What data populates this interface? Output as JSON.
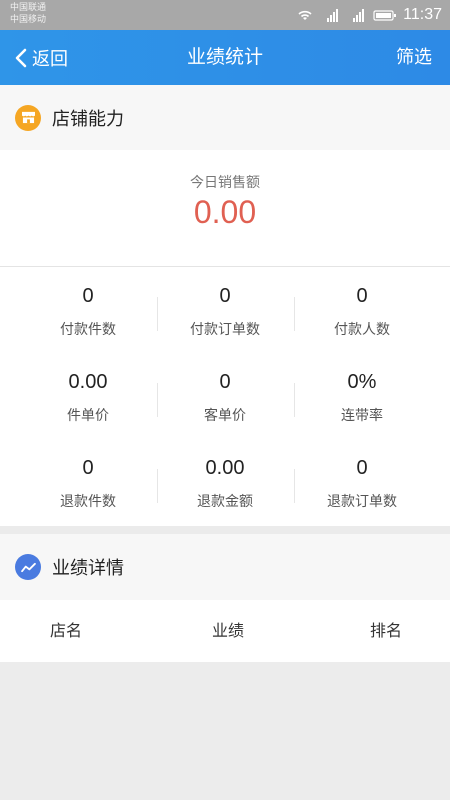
{
  "status_bar": {
    "carrier_1": "中国联通",
    "carrier_2": "中国移动",
    "time": "11:37"
  },
  "nav": {
    "back_label": "返回",
    "title": "业绩统计",
    "filter_label": "筛选"
  },
  "store": {
    "title": "店铺能力",
    "today_label": "今日销售额",
    "today_value": "0.00",
    "stats": [
      {
        "value": "0",
        "label": "付款件数"
      },
      {
        "value": "0",
        "label": "付款订单数"
      },
      {
        "value": "0",
        "label": "付款人数"
      },
      {
        "value": "0.00",
        "label": "件单价"
      },
      {
        "value": "0",
        "label": "客单价"
      },
      {
        "value": "0%",
        "label": "连带率"
      },
      {
        "value": "0",
        "label": "退款件数"
      },
      {
        "value": "0.00",
        "label": "退款金额"
      },
      {
        "value": "0",
        "label": "退款订单数"
      }
    ]
  },
  "detail": {
    "title": "业绩详情",
    "columns": [
      "店名",
      "业绩",
      "排名"
    ]
  },
  "colors": {
    "nav_blue": "#2f95e8",
    "accent_red": "#e06052",
    "store_icon_orange": "#f5a623",
    "detail_icon_blue": "#4a7be0"
  },
  "icons": {
    "back": "chevron-left-icon",
    "store": "store-icon",
    "detail": "trend-line-icon"
  }
}
